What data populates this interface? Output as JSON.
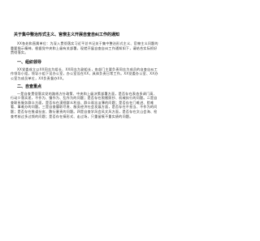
{
  "document": {
    "title": "关于集中整治形式主义、官僚主义开展自查自纠工作的通知",
    "intro": "XX各处和直属单位：为深入贯彻落实习近平总书记关于集中整治形式主义、官僚主义问题的重要指示精神，根据党中央和上级有关部署，现就开展自查自纠工作通知如下，请结合实际抓好贯彻落实。",
    "sections": [
      {
        "heading": "一、组织领导",
        "body": "XX党委成立以XX同志为组长、XX同志为副组长，各部门主要负责同志为成员的自查自纠工作领导小组，领导小组下设办公室，办公室设在XX，具体负责日常工作。XX党委办公室、XX办公室为成员单位，XX负责督办XX。"
      },
      {
        "heading": "二、自查重点",
        "body": "一是自查贯彻落实党的路线方针政策、中央和上级决策部署方面，是否存在表态多调门高、行动少落实差，不作为、慢作为、乱作为的问题；是否存在照搬照抄、机械执行的问题。二是自查联系服务群众方面，是否存在漠视群众利益、群众观念淡薄的问题；是否存在门难进、脸难看、事难办的问题。三是自查履职尽责、服务经济社会发展方面，是否存在不担当、不作为的问题；是否存在推诿扯皮、敷衍塞责的问题。四是自查学风会风文风方面，是否存在文山会海、检查考核过多过频的问题；是否存在搞形式、走过场，只重留痕不重实绩的问题。"
      }
    ]
  }
}
